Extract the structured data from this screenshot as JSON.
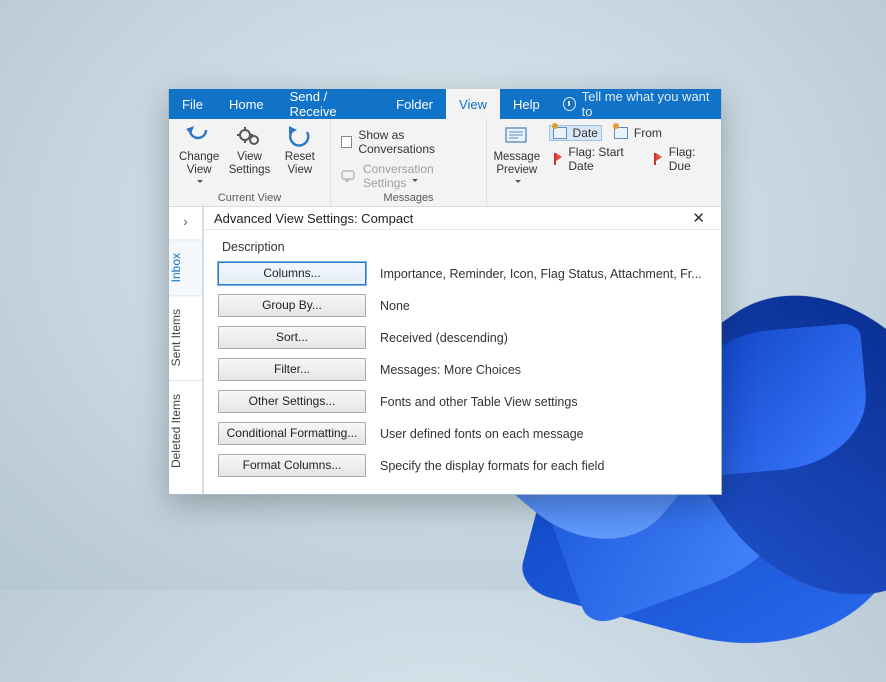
{
  "menu": {
    "file": "File",
    "home": "Home",
    "sendreceive": "Send / Receive",
    "folder": "Folder",
    "view": "View",
    "help": "Help",
    "tellme": "Tell me what you want to"
  },
  "ribbon": {
    "current_view": {
      "label": "Current View",
      "change_view": "Change View",
      "view_settings": "View Settings",
      "reset_view": "Reset View"
    },
    "messages": {
      "label": "Messages",
      "show_as_conversations": "Show as Conversations",
      "conversation_settings": "Conversation Settings"
    },
    "arrangement": {
      "message_preview": "Message Preview",
      "date": "Date",
      "from": "From",
      "flag_start": "Flag: Start Date",
      "flag_due": "Flag: Due"
    }
  },
  "side_tabs": [
    "Inbox",
    "Sent Items",
    "Deleted Items"
  ],
  "dialog": {
    "title": "Advanced View Settings: Compact",
    "description_label": "Description",
    "rows": [
      {
        "btn": "Columns...",
        "val": "Importance, Reminder, Icon, Flag Status, Attachment, Fr..."
      },
      {
        "btn": "Group By...",
        "val": "None"
      },
      {
        "btn": "Sort...",
        "val": "Received (descending)"
      },
      {
        "btn": "Filter...",
        "val": "Messages: More Choices"
      },
      {
        "btn": "Other Settings...",
        "val": "Fonts and other Table View settings"
      },
      {
        "btn": "Conditional Formatting...",
        "val": "User defined fonts on each message"
      },
      {
        "btn": "Format Columns...",
        "val": "Specify the display formats for each field"
      }
    ]
  }
}
